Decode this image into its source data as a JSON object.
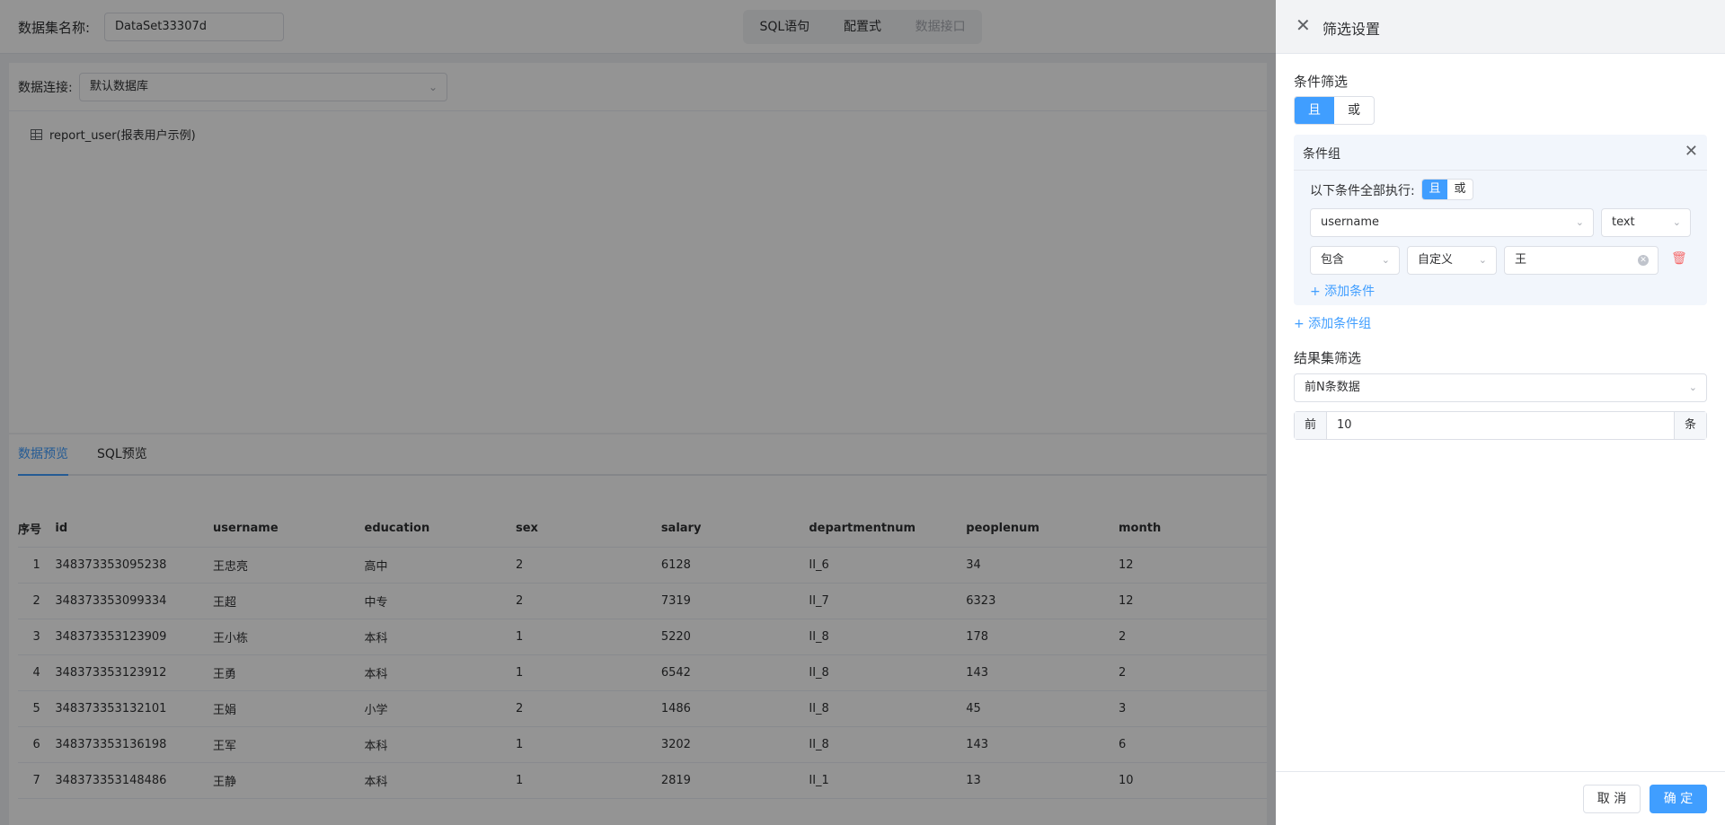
{
  "header": {
    "dataset_label": "数据集名称:",
    "dataset_name": "DataSet33307d",
    "tabs": [
      {
        "label": "SQL语句"
      },
      {
        "label": "配置式"
      },
      {
        "label": "数据接口"
      }
    ]
  },
  "connection": {
    "label": "数据连接:",
    "value": "默认数据库",
    "table_name": "report_user(报表用户示例)"
  },
  "preview": {
    "tabs": [
      {
        "label": "数据预览"
      },
      {
        "label": "SQL预览"
      }
    ],
    "columns": [
      "序号",
      "id",
      "username",
      "education",
      "sex",
      "salary",
      "departmentnum",
      "peoplenum",
      "month"
    ],
    "rows": [
      [
        "1",
        "348373353095238",
        "王忠亮",
        "高中",
        "2",
        "6128",
        "II_6",
        "34",
        "12"
      ],
      [
        "2",
        "348373353099334",
        "王超",
        "中专",
        "2",
        "7319",
        "II_7",
        "6323",
        "12"
      ],
      [
        "3",
        "348373353123909",
        "王小栋",
        "本科",
        "1",
        "5220",
        "II_8",
        "178",
        "2"
      ],
      [
        "4",
        "348373353123912",
        "王勇",
        "本科",
        "1",
        "6542",
        "II_8",
        "143",
        "2"
      ],
      [
        "5",
        "348373353132101",
        "王娟",
        "小学",
        "2",
        "1486",
        "II_8",
        "45",
        "3"
      ],
      [
        "6",
        "348373353136198",
        "王军",
        "本科",
        "1",
        "3202",
        "II_8",
        "143",
        "6"
      ],
      [
        "7",
        "348373353148486",
        "王静",
        "本科",
        "1",
        "2819",
        "II_1",
        "13",
        "10"
      ]
    ]
  },
  "drawer": {
    "title": "筛选设置",
    "condition_section": "条件筛选",
    "logic": {
      "and": "且",
      "or": "或"
    },
    "group": {
      "title": "条件组",
      "exec_label": "以下条件全部执行:",
      "field": "username",
      "field_type": "text",
      "operator": "包含",
      "value_mode": "自定义",
      "value": "王",
      "add_condition": "+ 添加条件"
    },
    "add_group": "+ 添加条件组",
    "result_section": "结果集筛选",
    "result_mode": "前N条数据",
    "top_prefix": "前",
    "top_value": "10",
    "top_suffix": "条",
    "cancel": "取 消",
    "confirm": "确 定"
  },
  "colors": {
    "accent": "#409eff",
    "danger": "#f56c6c"
  }
}
